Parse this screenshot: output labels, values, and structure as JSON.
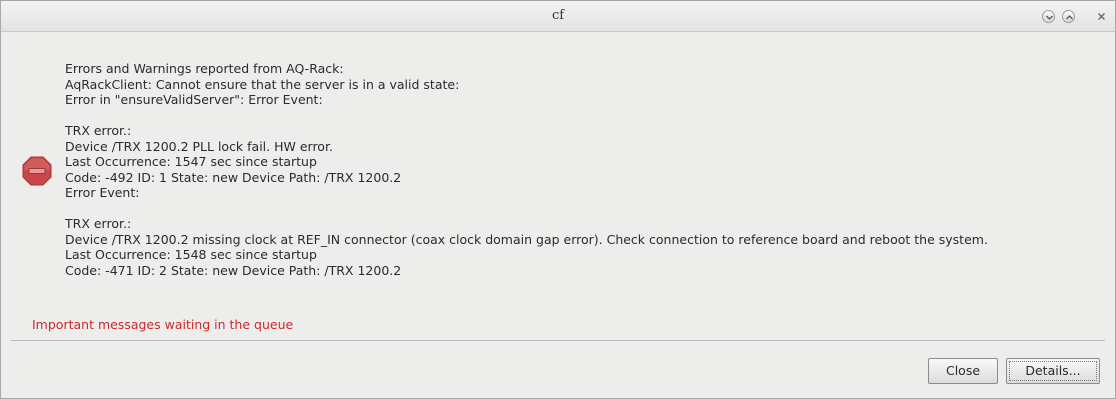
{
  "window": {
    "title": "cf",
    "controls": [
      "minimize",
      "maximize",
      "close"
    ]
  },
  "dialog": {
    "icon": "stop-icon",
    "message_lines": [
      "Errors and Warnings reported from AQ-Rack:",
      "AqRackClient: Cannot ensure that the server is in a valid state:",
      "Error in \"ensureValidServer\": Error Event:",
      "",
      "TRX error.:",
      "Device /TRX 1200.2 PLL lock fail. HW error.",
      "Last Occurrence: 1547 sec since startup",
      "Code: -492 ID: 1 State: new Device Path: /TRX 1200.2",
      "Error Event:",
      "",
      "TRX error.:",
      "Device /TRX 1200.2 missing clock at REF_IN connector (coax clock domain gap error). Check connection to reference board and reboot the system.",
      "Last Occurrence: 1548 sec since startup",
      "Code: -471 ID: 2 State: new Device Path: /TRX 1200.2"
    ],
    "queue_warning": "Important messages waiting in the queue",
    "queue_warning_color": "#cc2a2a"
  },
  "buttons": {
    "close_label": "Close",
    "details_label": "Details..."
  }
}
